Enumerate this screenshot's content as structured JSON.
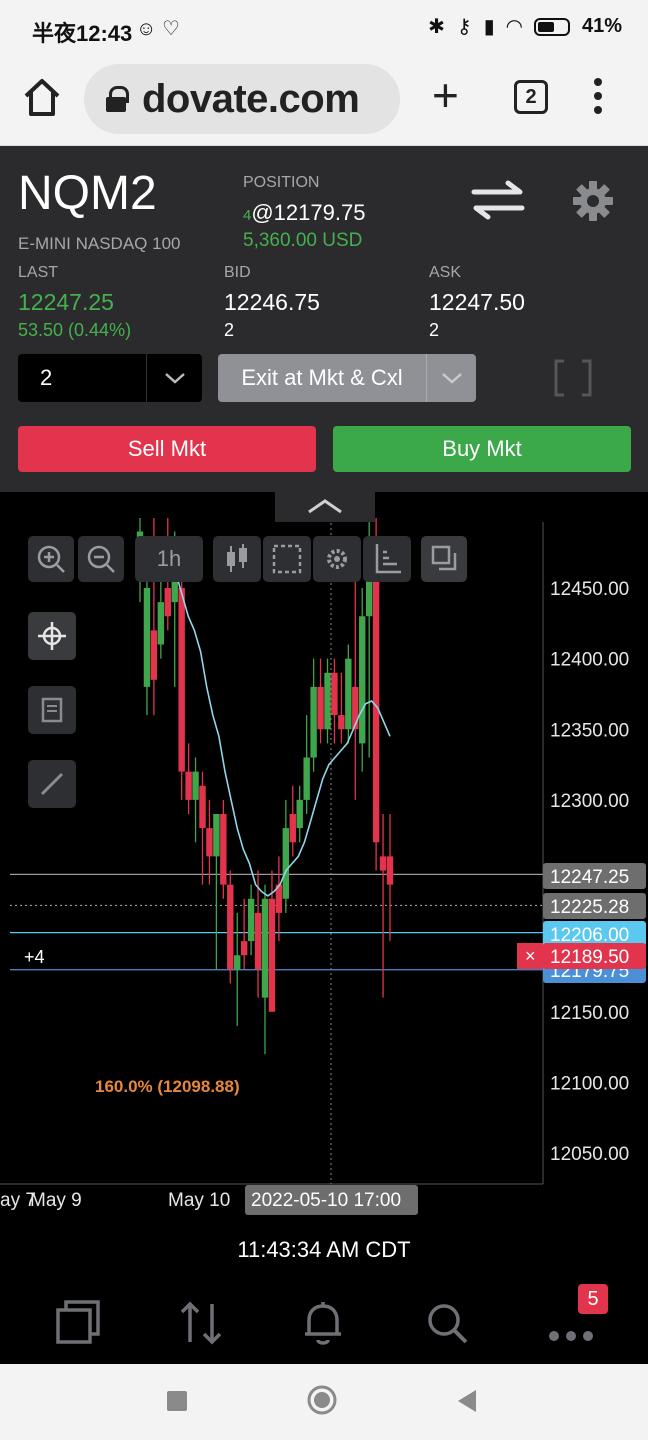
{
  "status": {
    "time": "半夜12:43",
    "battery": "41%"
  },
  "browser": {
    "url": "dovate.com",
    "tab_count": "2"
  },
  "instrument": {
    "symbol": "NQM2",
    "description": "E-MINI NASDAQ 100",
    "position_label": "POSITION",
    "position_qty": "4",
    "position_price": "@12179.75",
    "position_pnl": "5,360.00 USD"
  },
  "quotes": {
    "last_label": "LAST",
    "last_price": "12247.25",
    "last_change": "53.50 (0.44%)",
    "bid_label": "BID",
    "bid_price": "12246.75",
    "bid_size": "2",
    "ask_label": "ASK",
    "ask_price": "12247.50",
    "ask_size": "2"
  },
  "order": {
    "quantity": "2",
    "exit_label": "Exit at Mkt & Cxl",
    "sell_label": "Sell Mkt",
    "buy_label": "Buy Mkt"
  },
  "chart": {
    "interval": "1h",
    "crosshair_date": "2022-05-10 17:00",
    "fib_label": "160.0% (12098.88)",
    "position_marker": "+4",
    "cancel_icon": "×"
  },
  "chart_data": {
    "type": "candlestick",
    "ylim": [
      12020,
      12500
    ],
    "y_ticks": [
      "12450.00",
      "12400.00",
      "12350.00",
      "12300.00",
      "12150.00",
      "12100.00",
      "12050.00"
    ],
    "x_ticks": [
      "ay 7",
      "May 9",
      "May 10"
    ],
    "price_tags": [
      {
        "label": "12247.25",
        "value": 12247.25,
        "color": "#6e6e6e"
      },
      {
        "label": "12225.28",
        "value": 12225.28,
        "color": "#6e6e6e"
      },
      {
        "label": "12206.00",
        "value": 12206.0,
        "color": "#5bc8f0"
      },
      {
        "label": "12189.50",
        "value": 12189.5,
        "color": "#e2354d"
      },
      {
        "label": "12179.75",
        "value": 12179.75,
        "color": "#4b8fd6"
      }
    ],
    "lines": [
      {
        "value": 12247.25,
        "color": "#9a9a9a",
        "style": "solid"
      },
      {
        "value": 12225.28,
        "color": "#9a9a9a",
        "style": "dotted"
      },
      {
        "value": 12206.0,
        "color": "#5bc8f0",
        "style": "solid"
      },
      {
        "value": 12179.75,
        "color": "#4b8fd6",
        "style": "solid"
      }
    ],
    "candles": [
      {
        "o": 12460,
        "h": 12500,
        "l": 12440,
        "c": 12490
      },
      {
        "o": 12380,
        "h": 12480,
        "l": 12360,
        "c": 12450
      },
      {
        "o": 12420,
        "h": 12500,
        "l": 12360,
        "c": 12385
      },
      {
        "o": 12410,
        "h": 12470,
        "l": 12400,
        "c": 12440
      },
      {
        "o": 12450,
        "h": 12500,
        "l": 12420,
        "c": 12430
      },
      {
        "o": 12440,
        "h": 12490,
        "l": 12380,
        "c": 12460
      },
      {
        "o": 12450,
        "h": 12480,
        "l": 12300,
        "c": 12320
      },
      {
        "o": 12320,
        "h": 12340,
        "l": 12290,
        "c": 12300
      },
      {
        "o": 12300,
        "h": 12330,
        "l": 12270,
        "c": 12320
      },
      {
        "o": 12310,
        "h": 12320,
        "l": 12240,
        "c": 12280
      },
      {
        "o": 12280,
        "h": 12300,
        "l": 12240,
        "c": 12260
      },
      {
        "o": 12260,
        "h": 12290,
        "l": 12180,
        "c": 12290
      },
      {
        "o": 12290,
        "h": 12300,
        "l": 12230,
        "c": 12240
      },
      {
        "o": 12240,
        "h": 12250,
        "l": 12170,
        "c": 12180
      },
      {
        "o": 12180,
        "h": 12220,
        "l": 12140,
        "c": 12190
      },
      {
        "o": 12200,
        "h": 12230,
        "l": 12180,
        "c": 12190
      },
      {
        "o": 12200,
        "h": 12240,
        "l": 12190,
        "c": 12230
      },
      {
        "o": 12220,
        "h": 12250,
        "l": 12160,
        "c": 12180
      },
      {
        "o": 12160,
        "h": 12240,
        "l": 12120,
        "c": 12230
      },
      {
        "o": 12230,
        "h": 12250,
        "l": 12150,
        "c": 12150
      },
      {
        "o": 12240,
        "h": 12260,
        "l": 12200,
        "c": 12220
      },
      {
        "o": 12230,
        "h": 12300,
        "l": 12220,
        "c": 12280
      },
      {
        "o": 12290,
        "h": 12310,
        "l": 12260,
        "c": 12270
      },
      {
        "o": 12280,
        "h": 12310,
        "l": 12270,
        "c": 12300
      },
      {
        "o": 12300,
        "h": 12360,
        "l": 12290,
        "c": 12330
      },
      {
        "o": 12330,
        "h": 12400,
        "l": 12320,
        "c": 12380
      },
      {
        "o": 12380,
        "h": 12400,
        "l": 12340,
        "c": 12350
      },
      {
        "o": 12350,
        "h": 12400,
        "l": 12340,
        "c": 12390
      },
      {
        "o": 12390,
        "h": 12400,
        "l": 12340,
        "c": 12360
      },
      {
        "o": 12360,
        "h": 12390,
        "l": 12340,
        "c": 12350
      },
      {
        "o": 12350,
        "h": 12410,
        "l": 12340,
        "c": 12400
      },
      {
        "o": 12380,
        "h": 12470,
        "l": 12300,
        "c": 12350
      },
      {
        "o": 12340,
        "h": 12450,
        "l": 12320,
        "c": 12430
      },
      {
        "o": 12430,
        "h": 12500,
        "l": 12330,
        "c": 12470
      },
      {
        "o": 12480,
        "h": 12500,
        "l": 12250,
        "c": 12270
      },
      {
        "o": 12260,
        "h": 12290,
        "l": 12160,
        "c": 12250
      },
      {
        "o": 12260,
        "h": 12290,
        "l": 12200,
        "c": 12240
      }
    ],
    "ma": [
      12470,
      12460,
      12445,
      12430,
      12420,
      12405,
      12380,
      12360,
      12345,
      12320,
      12300,
      12280,
      12265,
      12255,
      12240,
      12235,
      12232,
      12235,
      12240,
      12250,
      12255,
      12260,
      12270,
      12285,
      12300,
      12315,
      12325,
      12330,
      12335,
      12340,
      12350,
      12360,
      12368,
      12370,
      12365,
      12355,
      12345
    ]
  },
  "footer": {
    "time": "11:43:34 AM CDT",
    "notification_count": "5"
  }
}
